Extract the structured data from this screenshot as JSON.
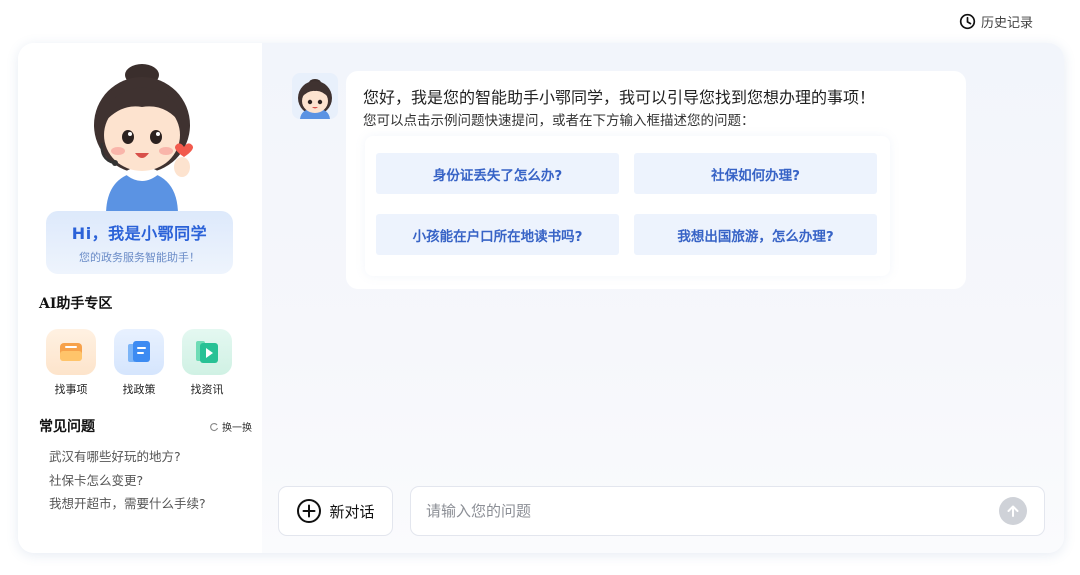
{
  "header": {
    "history_label": "历史记录",
    "history_icon": "clock-icon"
  },
  "sidebar": {
    "mascot_icon": "mascot-girl-icon",
    "greeting_title": "Hi，我是小鄂同学",
    "greeting_subtitle": "您的政务服务智能助手！",
    "ai_section_title": "AI助手专区",
    "tools": [
      {
        "label": "找事项",
        "icon": "mail-card-icon",
        "color": "#f7a24b"
      },
      {
        "label": "找政策",
        "icon": "document-icon",
        "color": "#3d8bf2"
      },
      {
        "label": "找资讯",
        "icon": "video-play-icon",
        "color": "#28c195"
      }
    ],
    "faq_title": "常见问题",
    "refresh_label": "换一换",
    "faq_items": [
      "武汉有哪些好玩的地方?",
      "社保卡怎么变更?",
      "我想开超市，需要什么手续?"
    ]
  },
  "chat": {
    "greeting": "您好，我是您的智能助手小鄂同学，我可以引导您找到您想办理的事项！",
    "instruction": "您可以点击示例问题快速提问，或者在下方输入框描述您的问题：",
    "examples": [
      "身份证丢失了怎么办?",
      "社保如何办理?",
      "小孩能在户口所在地读书吗?",
      "我想出国旅游，怎么办理?"
    ]
  },
  "composer": {
    "new_chat_label": "新对话",
    "placeholder": "请输入您的问题",
    "send_icon": "arrow-up-icon"
  },
  "colors": {
    "accent": "#2b62d8",
    "example_bg": "#edf3fd",
    "example_text": "#3763c6"
  }
}
